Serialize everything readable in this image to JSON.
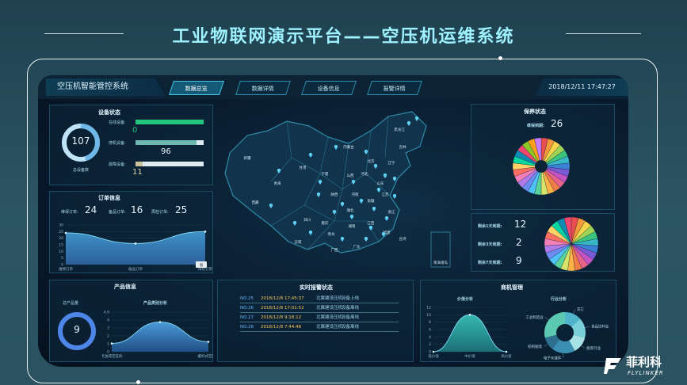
{
  "slide": {
    "title": "工业物联网演示平台——空压机运维系统"
  },
  "header": {
    "system_title": "空压机智能管控系统",
    "tabs": [
      "数据总览",
      "数据详情",
      "设备信息",
      "报警详情"
    ],
    "active_tab": 0,
    "datetime": "2018/12/11 17:47:27"
  },
  "device_status": {
    "title": "设备状态",
    "total": "107",
    "total_label": "总设备数",
    "rows": [
      {
        "label": "在线设备:",
        "value": "0",
        "fraction": 1.0,
        "color": "#22c47e"
      },
      {
        "label": "停机设备:",
        "value": "96",
        "fraction": 0.9,
        "color": "#6fb6b0"
      },
      {
        "label": "故障设备:",
        "value": "11",
        "fraction": 0.1,
        "color": "#c8c39a"
      }
    ]
  },
  "orders": {
    "title": "订单信息",
    "items": [
      {
        "label": "维保订单:",
        "value": "24"
      },
      {
        "label": "备品订单:",
        "value": "16"
      },
      {
        "label": "再检订单:",
        "value": "25"
      }
    ],
    "chart_data": {
      "type": "area",
      "categories": [
        "维保订单",
        "备品订单",
        "再检订单"
      ],
      "values": [
        24,
        16,
        25
      ],
      "ylim": [
        0,
        30
      ],
      "yticks": [
        "30",
        "25",
        "20",
        "15",
        "10",
        "5",
        "0"
      ],
      "tooltip": "值"
    }
  },
  "product": {
    "title": "产品信息",
    "total_label": "总产品量",
    "total": "9",
    "analysis_title": "产品类别分析",
    "chart_data": {
      "type": "area",
      "categories": [
        "无油或空压机",
        "螺杆式空压机"
      ],
      "values": [
        1,
        3.6,
        1.2
      ],
      "ylim": [
        0,
        4.8
      ],
      "yticks": [
        "4.8",
        "4",
        "3",
        "2",
        "1",
        "0"
      ]
    }
  },
  "maintenance": {
    "title": "保养状态",
    "due_label": "维保到期:",
    "due_value": "26",
    "chart_data": {
      "type": "pie",
      "slices": [
        1,
        1,
        1,
        1,
        1,
        1,
        1,
        1,
        1,
        1,
        1,
        1,
        1,
        1,
        1,
        1,
        1,
        1,
        1,
        1,
        1,
        1,
        1,
        1,
        1,
        1
      ],
      "colors": [
        "#e94e4e",
        "#f59a3b",
        "#f7d54a",
        "#9fd356",
        "#3bc47e",
        "#39b6c8",
        "#3b82d6",
        "#7a5bd6",
        "#c454c6",
        "#e8638b",
        "#f07c4a",
        "#ffb347",
        "#d8e36a",
        "#5ad39b",
        "#4fc3f7",
        "#6c8cf2",
        "#b07be8",
        "#f27fb8",
        "#ff6f61",
        "#ffd166",
        "#06d6a0",
        "#118ab2",
        "#ef476f",
        "#8ac926",
        "#ff9f1c",
        "#c77dff"
      ]
    }
  },
  "remaining": {
    "rows": [
      {
        "label": "剩余1天到期:",
        "value": "12"
      },
      {
        "label": "剩余3天到期:",
        "value": "2"
      },
      {
        "label": "剩余7天到期:",
        "value": "9"
      }
    ],
    "chart_data": {
      "type": "pie",
      "slices": [
        1,
        1,
        1,
        1,
        1,
        1,
        1,
        1,
        1,
        1,
        1,
        1,
        1,
        1,
        1,
        1,
        1,
        1,
        1,
        1,
        1,
        1,
        1
      ],
      "colors": [
        "#e94e4e",
        "#f59a3b",
        "#f7d54a",
        "#9fd356",
        "#3bc47e",
        "#39b6c8",
        "#3b82d6",
        "#7a5bd6",
        "#c454c6",
        "#e8638b",
        "#f07c4a",
        "#ffb347",
        "#d8e36a",
        "#5ad39b",
        "#4fc3f7",
        "#6c8cf2",
        "#b07be8",
        "#f27fb8",
        "#ff6f61",
        "#ffd166",
        "#06d6a0",
        "#118ab2",
        "#ef476f"
      ]
    }
  },
  "alarms": {
    "title": "实时报警状态",
    "rows": [
      {
        "no": "NO.25",
        "time": "2018/12/8 17:45:37",
        "device": "北翼建设压机",
        "status": "设备上线"
      },
      {
        "no": "NO.26",
        "time": "2018/12/8 17:01:52",
        "device": "北翼建设压机",
        "status": "设备离线"
      },
      {
        "no": "NO.27",
        "time": "2018/12/8 9:18:12",
        "device": "北翼建设压机",
        "status": "设备离线"
      },
      {
        "no": "NO.28",
        "time": "2018/12/8 7:44:48",
        "device": "北翼建设压机",
        "status": "设备离线"
      }
    ]
  },
  "market": {
    "title": "商机管理",
    "price_title": "价值分析",
    "industry_title": "行业分析",
    "price_chart": {
      "type": "area",
      "categories": [
        "低价值",
        "中价值",
        "高价值"
      ],
      "values": [
        0,
        10,
        0
      ],
      "ylim": [
        0,
        12
      ],
      "yticks": [
        "12",
        "10",
        "8",
        "6",
        "4",
        "2",
        "0"
      ]
    },
    "industry_chart": {
      "type": "pie",
      "labels": [
        "其它",
        "食品饮料业",
        "服装行业",
        "电子元器件",
        "纺织服装",
        "工业制造业"
      ],
      "slices": [
        1,
        1.2,
        1,
        1.4,
        0.8,
        2.2
      ],
      "colors": [
        "#4fb3c9",
        "#7ad0d8",
        "#a7e3e6",
        "#3b8fb3",
        "#2f6f8f",
        "#5ccab2"
      ]
    }
  },
  "map": {
    "labels": [
      "新疆",
      "西藏",
      "青海",
      "甘肃",
      "内蒙古",
      "黑龙江",
      "吉林",
      "辽宁",
      "北京",
      "宁夏",
      "陕西",
      "山西",
      "河北",
      "山东",
      "河南",
      "四川",
      "重庆",
      "湖北",
      "安徽",
      "江苏",
      "贵州",
      "湖南",
      "江西",
      "浙江",
      "云南",
      "广西",
      "广东",
      "福建",
      "台湾",
      "南海诸岛"
    ]
  },
  "brand": {
    "name": "菲利科",
    "sub": "FLYLINKER"
  }
}
